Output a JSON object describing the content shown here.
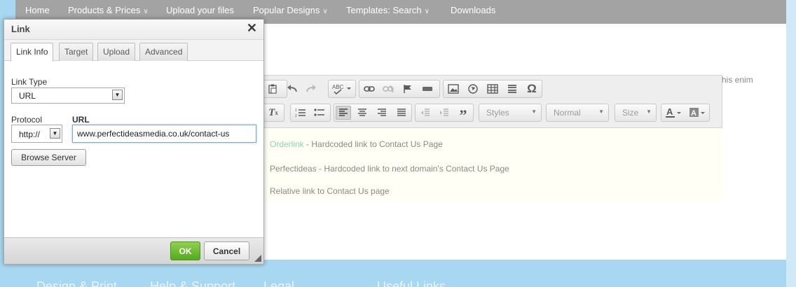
{
  "nav": {
    "items": [
      {
        "label": "Home",
        "has_menu": false
      },
      {
        "label": "Products & Prices",
        "has_menu": true
      },
      {
        "label": "Upload your files",
        "has_menu": false
      },
      {
        "label": "Popular Designs",
        "has_menu": true
      },
      {
        "label": "Templates: Search",
        "has_menu": true
      },
      {
        "label": "Downloads",
        "has_menu": false
      }
    ],
    "chevron": "∨"
  },
  "page": {
    "snippet": "his enim"
  },
  "footer": {
    "headings": [
      "Design & Print",
      "Help & Support",
      "Legal",
      "Useful Links"
    ]
  },
  "editor": {
    "toolbar": {
      "styles_label": "Styles",
      "format_label": "Normal",
      "size_label": "Size"
    },
    "content": {
      "line1_link": "Orderlink",
      "line1_text": " - Hardcoded link to Contact Us Page",
      "line2": "Perfectideas - Hardcoded link to next domain's Contact Us Page",
      "line3": "Relative link to Contact Us page"
    }
  },
  "dialog": {
    "title": "Link",
    "close": "✕",
    "tabs": [
      "Link Info",
      "Target",
      "Upload",
      "Advanced"
    ],
    "active_tab": "Link Info",
    "link_type_label": "Link Type",
    "link_type_value": "URL",
    "protocol_label": "Protocol",
    "protocol_value": "http://",
    "url_label": "URL",
    "url_value": "www.perfectideasmedia.co.uk/contact-us",
    "browse_label": "Browse Server",
    "ok_label": "OK",
    "cancel_label": "Cancel"
  },
  "colors": {
    "nav_bg": "#a3a3a3",
    "footer_bg": "#a8d7f2",
    "ok_green": "#55a821",
    "link_green": "#8cd3b0"
  }
}
